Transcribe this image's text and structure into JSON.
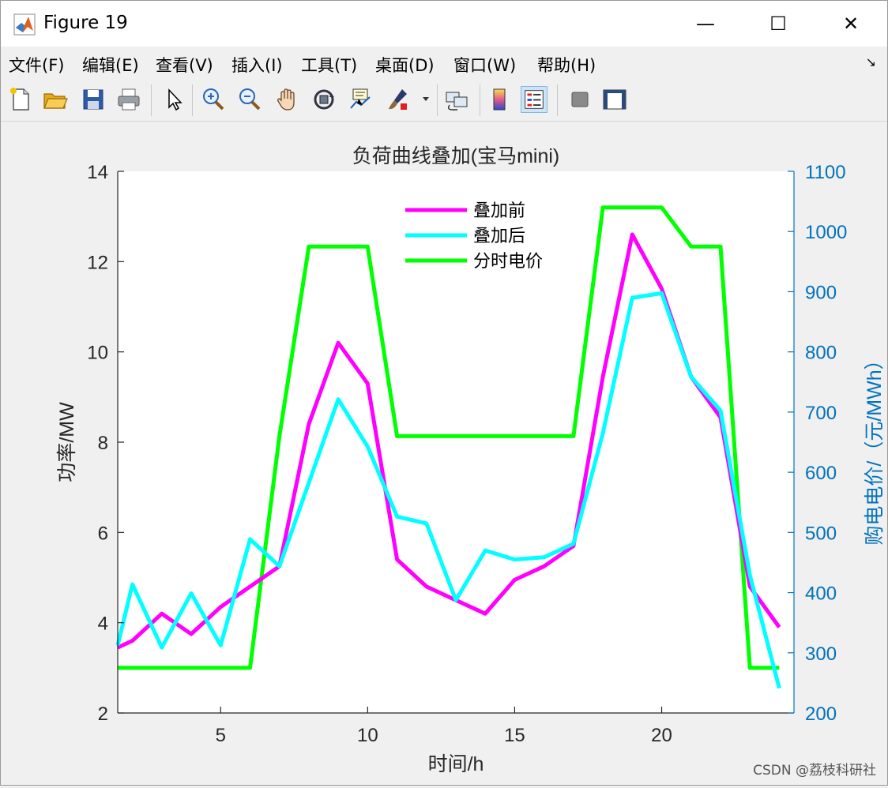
{
  "window": {
    "title": "Figure 19",
    "controls": {
      "minimize": "—",
      "maximize": "☐",
      "close": "✕"
    }
  },
  "menu": [
    {
      "label": "文件(F)"
    },
    {
      "label": "编辑(E)"
    },
    {
      "label": "查看(V)"
    },
    {
      "label": "插入(I)"
    },
    {
      "label": "工具(T)"
    },
    {
      "label": "桌面(D)"
    },
    {
      "label": "窗口(W)"
    },
    {
      "label": "帮助(H)"
    }
  ],
  "toolbar": {
    "icons": [
      "new-file-icon",
      "open-folder-icon",
      "save-icon",
      "print-icon",
      "pointer-icon",
      "zoom-in-icon",
      "zoom-out-icon",
      "pan-hand-icon",
      "rotate-3d-icon",
      "data-cursor-icon",
      "brush-icon",
      "link-plot-icon",
      "colorbar-icon",
      "legend-icon",
      "hide-plot-tools-icon",
      "show-plot-tools-icon"
    ]
  },
  "watermark": "CSDN @荔枝科研社",
  "colors": {
    "magenta": "#ff00ff",
    "cyan": "#00ffff",
    "green": "#00ff00",
    "right_axis": "#0072bd"
  },
  "chart_data": {
    "type": "line",
    "title": "负荷曲线叠加(宝马mini)",
    "xlabel": "时间/h",
    "ylabel": "功率/MW",
    "y2label": "购电电价/（元/MWh）",
    "xlim": [
      1.5,
      24.5
    ],
    "ylim": [
      2,
      14
    ],
    "y2lim": [
      200,
      1100
    ],
    "xticks": [
      5,
      10,
      15,
      20
    ],
    "yticks": [
      2,
      4,
      6,
      8,
      10,
      12,
      14
    ],
    "y2ticks": [
      200,
      300,
      400,
      500,
      600,
      700,
      800,
      900,
      1000,
      1100
    ],
    "legend_position": "top-center",
    "series": [
      {
        "name": "叠加前",
        "axis": "left",
        "color": "#ff00ff",
        "x": [
          1.5,
          2,
          3,
          4,
          5,
          6,
          7,
          8,
          9,
          10,
          11,
          12,
          13,
          14,
          15,
          16,
          17,
          18,
          19,
          20,
          21,
          22,
          23,
          24
        ],
        "y": [
          3.45,
          3.6,
          4.2,
          3.75,
          4.35,
          4.8,
          5.25,
          8.4,
          10.2,
          9.3,
          5.4,
          4.8,
          4.5,
          4.2,
          4.95,
          5.25,
          5.7,
          9.45,
          12.6,
          11.4,
          9.45,
          8.55,
          4.8,
          3.9
        ]
      },
      {
        "name": "叠加后",
        "axis": "left",
        "color": "#00ffff",
        "x": [
          1.5,
          2,
          3,
          4,
          5,
          6,
          7,
          8,
          9,
          10,
          11,
          12,
          13,
          14,
          15,
          16,
          17,
          18,
          19,
          20,
          21,
          22,
          23,
          24
        ],
        "y": [
          3.5,
          4.85,
          3.45,
          4.65,
          3.5,
          5.85,
          5.25,
          7.1,
          8.95,
          7.9,
          6.35,
          6.2,
          4.5,
          5.6,
          5.4,
          5.45,
          5.75,
          8.2,
          11.2,
          11.3,
          9.45,
          8.7,
          5.05,
          2.55
        ]
      },
      {
        "name": "分时电价",
        "axis": "right",
        "color": "#00ff00",
        "x": [
          1.5,
          2,
          3,
          4,
          5,
          6,
          7,
          8,
          9,
          10,
          11,
          12,
          13,
          14,
          15,
          16,
          17,
          18,
          19,
          20,
          21,
          22,
          23,
          24
        ],
        "y": [
          275,
          275,
          275,
          275,
          275,
          275,
          660,
          975,
          975,
          975,
          660,
          660,
          660,
          660,
          660,
          660,
          660,
          1040,
          1040,
          1040,
          975,
          975,
          275,
          275
        ]
      }
    ]
  }
}
